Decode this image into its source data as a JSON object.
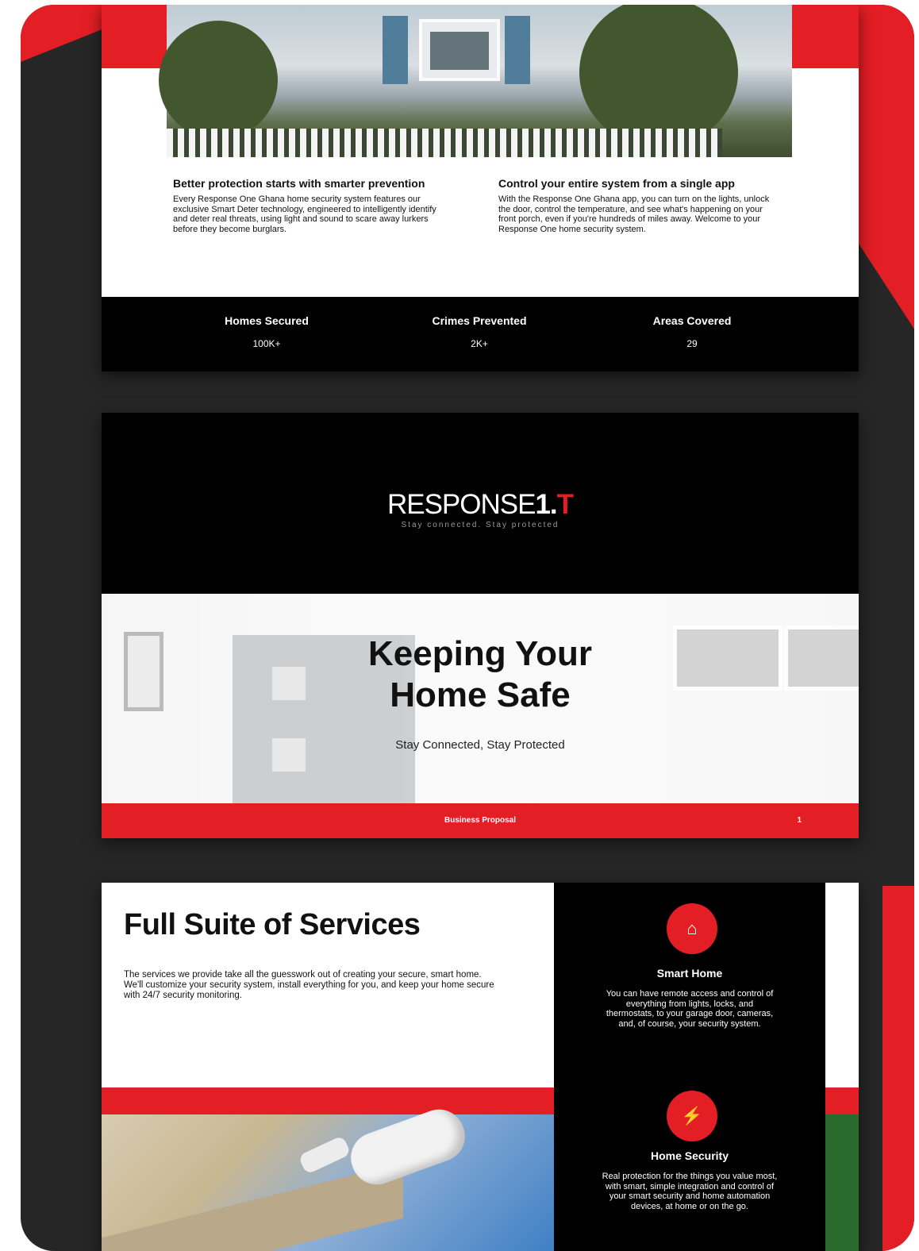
{
  "slide1": {
    "col1": {
      "title": "Better protection starts with smarter prevention",
      "body": "Every Response One Ghana home security system features our exclusive Smart Deter technology, engineered to intelligently identify and deter real threats, using light and sound to scare away lurkers before they become burglars."
    },
    "col2": {
      "title": "Control your entire system from a single app",
      "body": "With the Response One Ghana app, you can turn on the lights, unlock the door, control the temperature, and see what's happening on your front porch, even if you're hundreds of miles away. Welcome to your Response One home security system."
    },
    "stats": [
      {
        "label": "Homes Secured",
        "value": "100K+"
      },
      {
        "label": "Crimes Prevented",
        "value": "2K+"
      },
      {
        "label": "Areas Covered",
        "value": "29"
      }
    ]
  },
  "slide2": {
    "logo_name": "RESPONSE",
    "logo_one": "1.",
    "logo_t": "T",
    "logo_tagline": "Stay connected. Stay protected",
    "title_line1": "Keeping Your",
    "title_line2": "Home Safe",
    "subtitle": "Stay Connected, Stay Protected",
    "footer_label": "Business Proposal",
    "page_number": "1"
  },
  "slide3": {
    "title": "Full Suite of Services",
    "description": "The services we provide take all the guesswork out of creating your secure, smart home. We'll customize your security system, install everything for you, and keep your home secure with 24/7 security monitoring.",
    "services": [
      {
        "icon": "home-icon",
        "glyph": "⌂",
        "title": "Smart Home",
        "body": "You can have remote access and control of everything from lights, locks, and thermostats, to your garage door, cameras, and, of course, your security system."
      },
      {
        "icon": "plug-icon",
        "glyph": "⚡",
        "title": "Home Security",
        "body": "Real protection for the things you value most, with smart, simple integration and control of your smart security and home automation devices, at home or on the go."
      }
    ]
  },
  "colors": {
    "brand_red": "#e31e24",
    "dark_bg": "#262626",
    "black": "#000000"
  }
}
